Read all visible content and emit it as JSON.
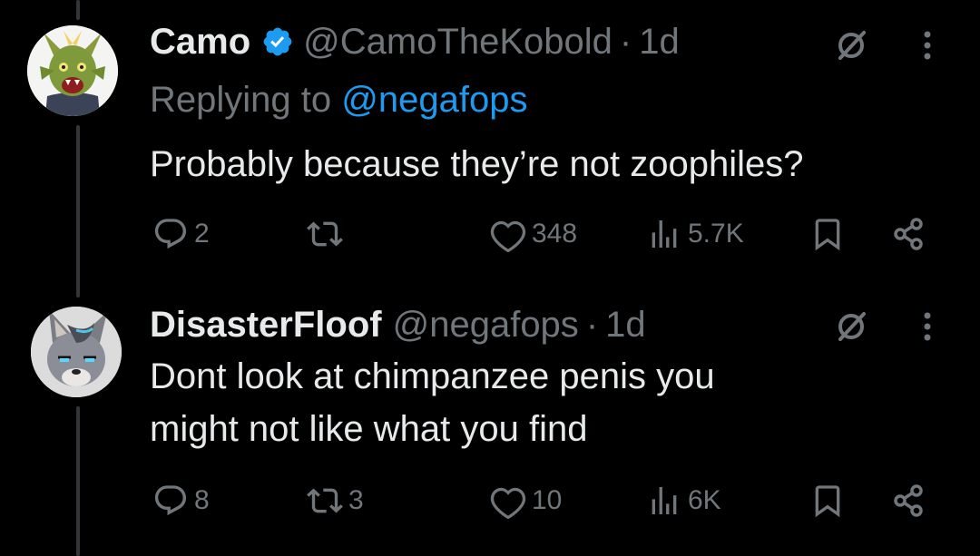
{
  "colors": {
    "background": "#000000",
    "text": "#e7e9ea",
    "secondary": "#71767b",
    "accent": "#1d9bf0",
    "thread_line": "#333639"
  },
  "tweets": [
    {
      "name": "Camo",
      "verified": true,
      "handle": "@CamoTheKobold",
      "separator": "·",
      "time": "1d",
      "replying_prefix": "Replying to",
      "replying_to": "@negafops",
      "text_lines": [
        "Probably because they’re not zoophiles?"
      ],
      "avatar": "green-kobold-avatar",
      "stats": {
        "replies": "2",
        "reposts": "",
        "likes": "348",
        "views": "5.7K"
      },
      "icons": [
        "reply-icon",
        "repost-icon",
        "like-icon",
        "views-icon",
        "bookmark-icon",
        "share-icon",
        "grok-icon",
        "more-icon"
      ]
    },
    {
      "name": "DisasterFloof",
      "verified": false,
      "handle": "@negafops",
      "separator": "·",
      "time": "1d",
      "text_lines": [
        "Dont look at chimpanzee penis you",
        "might not like what you find"
      ],
      "avatar": "grey-canine-avatar",
      "stats": {
        "replies": "8",
        "reposts": "3",
        "likes": "10",
        "views": "6K"
      },
      "icons": [
        "reply-icon",
        "repost-icon",
        "like-icon",
        "views-icon",
        "bookmark-icon",
        "share-icon",
        "grok-icon",
        "more-icon"
      ]
    }
  ]
}
